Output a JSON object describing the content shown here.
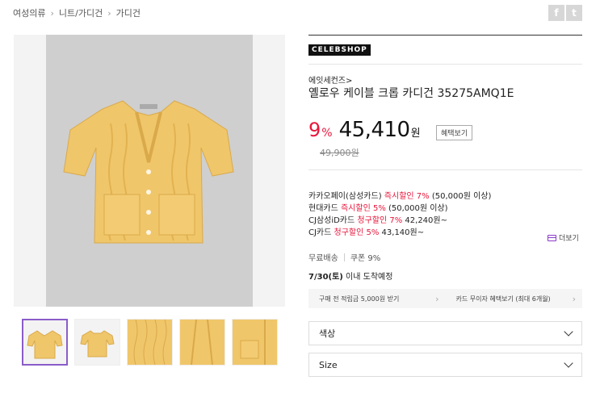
{
  "breadcrumb": [
    {
      "label": "여성의류"
    },
    {
      "label": "니트/가디건"
    },
    {
      "label": "가디건"
    }
  ],
  "breadcrumb_sep": "›",
  "share": {
    "facebook": "f",
    "twitter": "t"
  },
  "product": {
    "brand_logo": "CELEBSHOP",
    "brand_name": "에잇세컨즈>",
    "name": "옐로우 케이블 크롭 카디건 35275AMQ1E",
    "discount": "9",
    "discount_unit": "%",
    "sale_price": "45,410",
    "won": "원",
    "benefit_button": "혜택보기",
    "original_price": "49,900원"
  },
  "card_offers": {
    "row1": {
      "a": "카카오페이(삼성카드) ",
      "b": "즉시할인 7%",
      "c": " (50,000원 이상)"
    },
    "row2": {
      "a": "현대카드 ",
      "b": "즉시할인 5%",
      "c": " (50,000원 이상)"
    },
    "row3": {
      "a": "CJ삼성iD카드 ",
      "b": "청구할인 7%",
      "c": " 42,240원~"
    },
    "row4": {
      "a": "CJ카드 ",
      "b": "청구할인 5%",
      "c": " 43,140원~"
    },
    "more_label": "더보기"
  },
  "shipping": {
    "free": "무료배송",
    "coupon": "쿠폰 9%"
  },
  "arrival": {
    "date": "7/30(토)",
    "text": " 이내 도착예정"
  },
  "promo": {
    "left": "구매 전 적립금 5,000원 받기",
    "right": "카드 무이자 혜택보기 (최대 6개월)",
    "chevron": "›"
  },
  "options": {
    "color": "색상",
    "size": "Size"
  },
  "colors": {
    "accent": "#e8173c",
    "thumb_border": "#8a5cc9",
    "garment": "#f0c66b"
  }
}
